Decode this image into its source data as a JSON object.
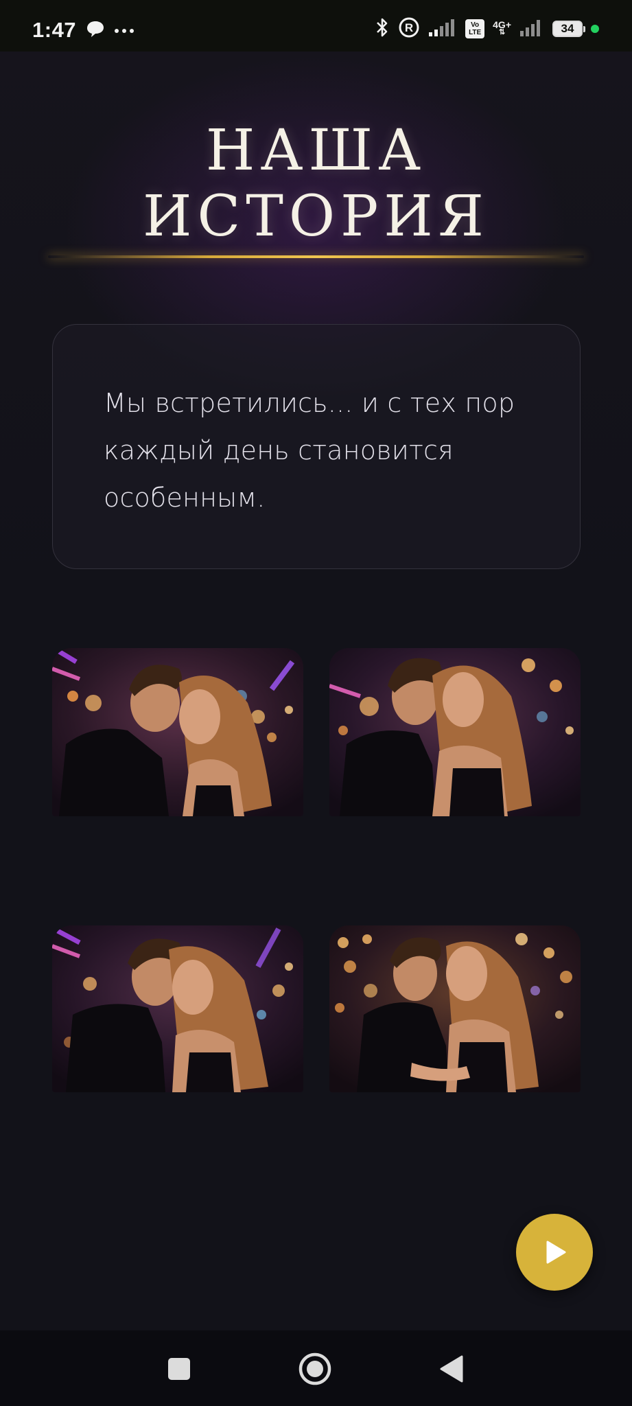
{
  "status_bar": {
    "time": "1:47",
    "network": "4G+",
    "volte": "Vo LTE",
    "battery": "34"
  },
  "icons": {
    "left": [
      "chat-bubble-icon",
      "more-dots-icon"
    ],
    "right": [
      "bluetooth-icon",
      "registered-icon",
      "signal-icon",
      "volte-icon",
      "network-4g-icon",
      "signal-icon",
      "battery-icon",
      "recording-dot-icon"
    ]
  },
  "page": {
    "title_line1": "НАША",
    "title_line2": "ИСТОРИЯ",
    "story_text": "Мы встретились... и с тех пор каждый день становится особенным."
  },
  "gallery": {
    "photos": [
      {
        "name": "photo-couple-kiss"
      },
      {
        "name": "photo-couple-smile"
      },
      {
        "name": "photo-couple-close"
      },
      {
        "name": "photo-couple-embrace"
      }
    ]
  },
  "colors": {
    "background": "#121219",
    "gold": "#d7b33a",
    "text": "#e3e1ea"
  }
}
